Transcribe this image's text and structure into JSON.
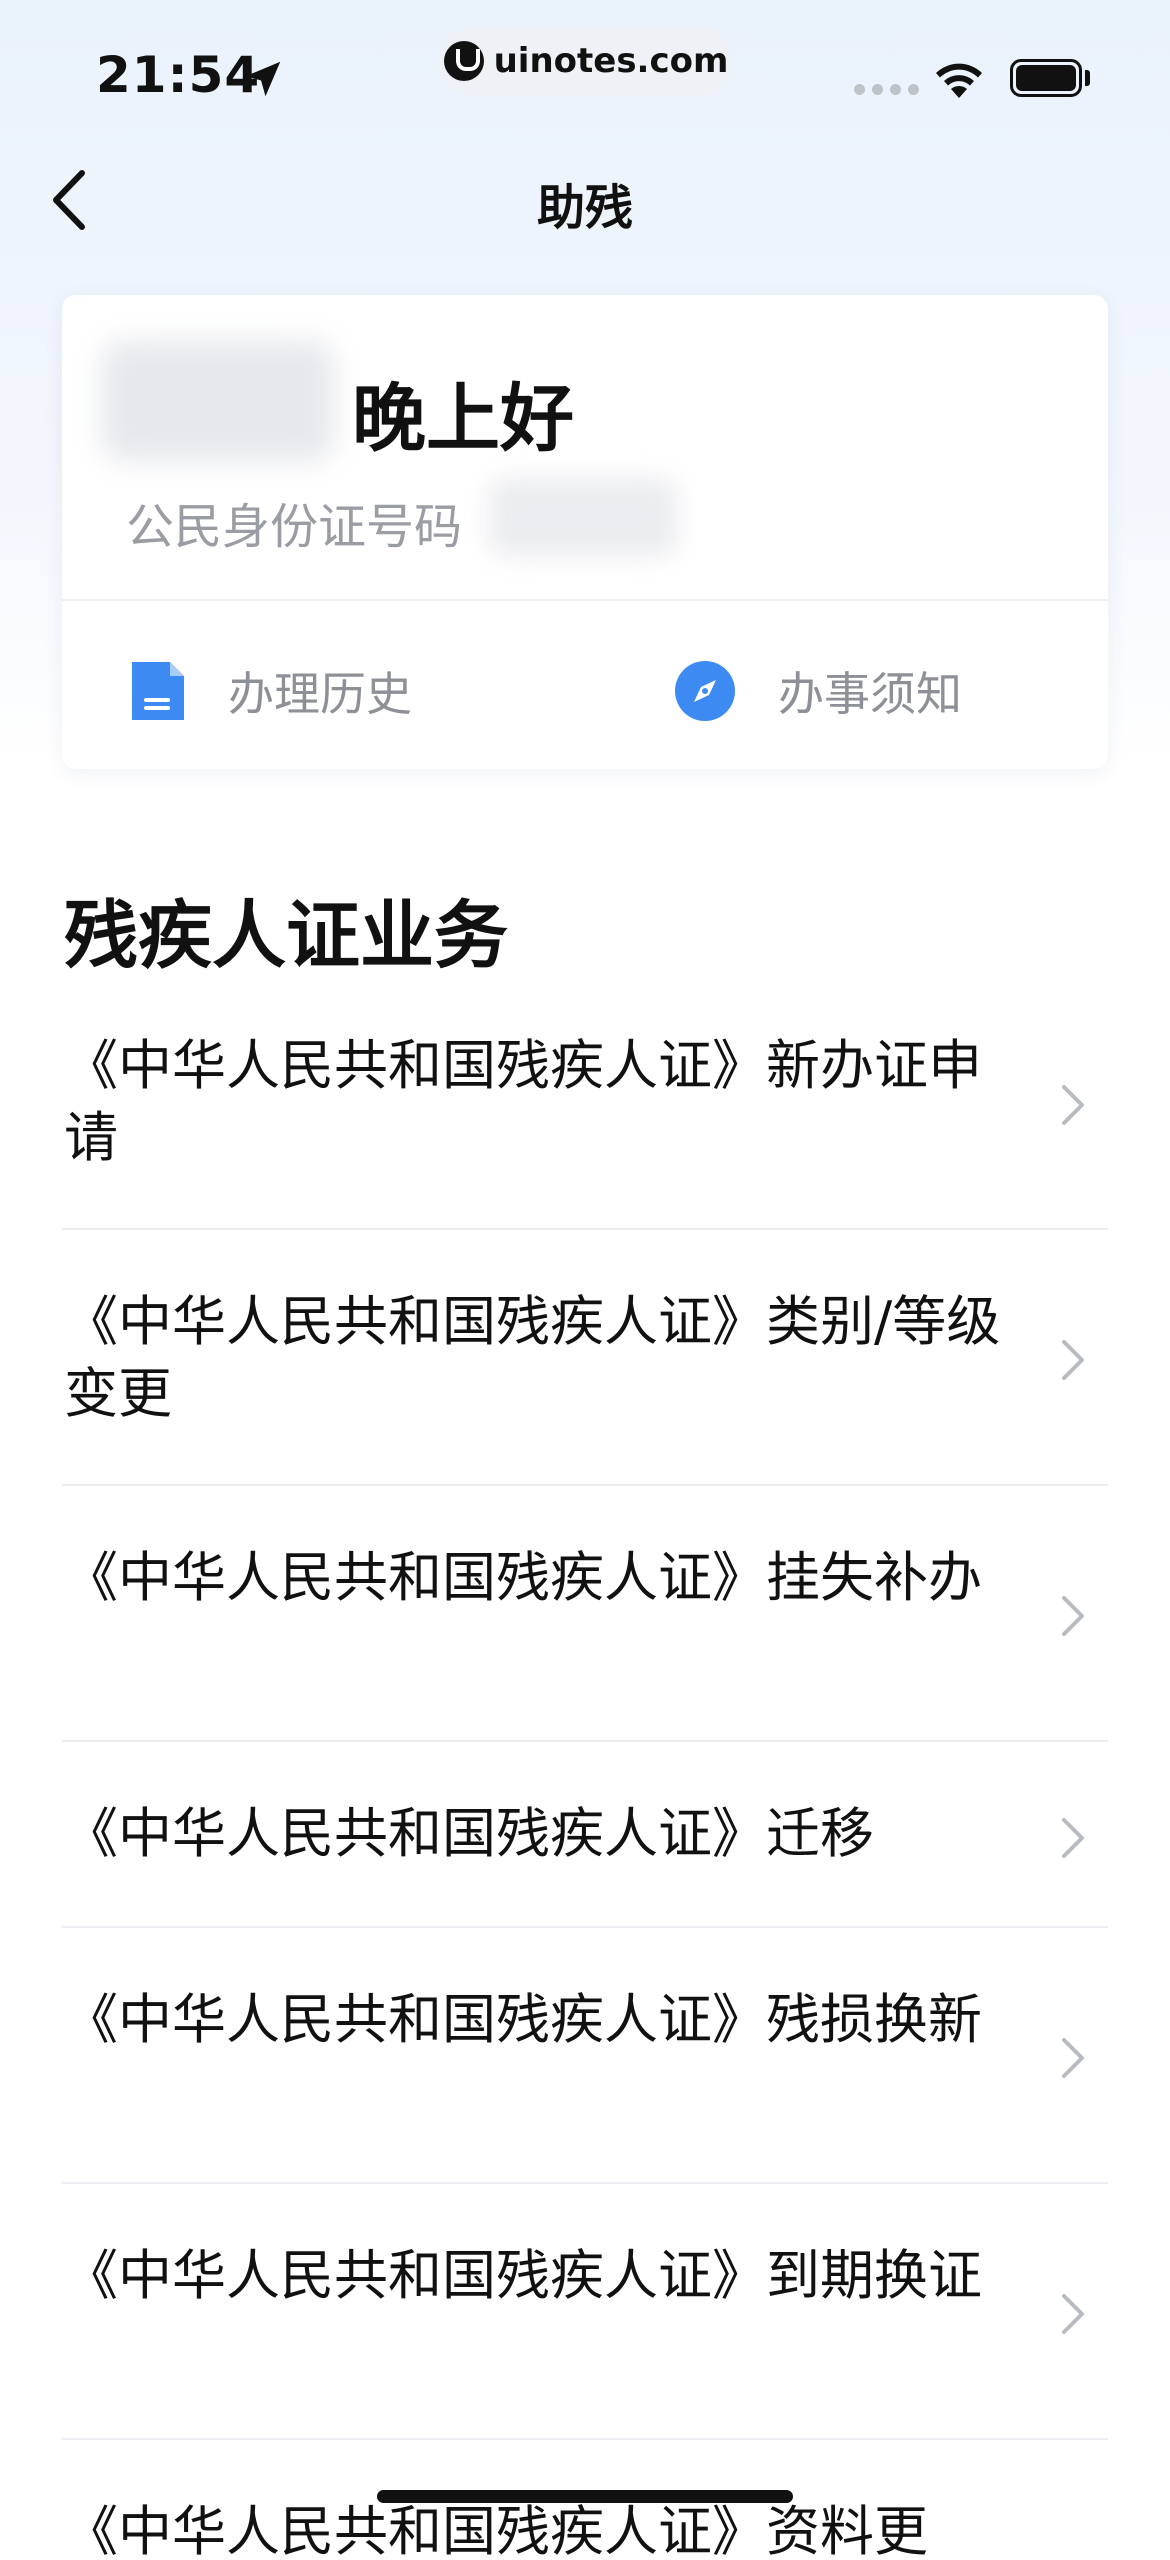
{
  "status_bar": {
    "time": "21:54",
    "url": "uinotes.com",
    "icons": [
      "location-arrow-icon",
      "cellular-signal-icon",
      "wifi-icon",
      "battery-icon"
    ]
  },
  "nav": {
    "title": "助残",
    "back_icon": "chevron-left-icon"
  },
  "profile": {
    "greeting": "晚上好",
    "id_label": "公民身份证号码",
    "actions": [
      {
        "label": "办理历史",
        "icon": "document-icon",
        "color": "#3d8bf2"
      },
      {
        "label": "办事须知",
        "icon": "compass-icon",
        "color": "#3d8bf2"
      }
    ]
  },
  "section": {
    "title": "残疾人证业务"
  },
  "services": [
    {
      "label": "《中华人民共和国残疾人证》新办证申请"
    },
    {
      "label": "《中华人民共和国残疾人证》类别/等级变更"
    },
    {
      "label": "《中华人民共和国残疾人证》挂失补办"
    },
    {
      "label": "《中华人民共和国残疾人证》迁移"
    },
    {
      "label": "《中华人民共和国残疾人证》残损换新"
    },
    {
      "label": "《中华人民共和国残疾人证》到期换证"
    },
    {
      "label": "《中华人民共和国残疾人证》资料更"
    }
  ],
  "colors": {
    "accent": "#3d8bf2",
    "text_primary": "#111111",
    "text_secondary": "#8d9096"
  }
}
